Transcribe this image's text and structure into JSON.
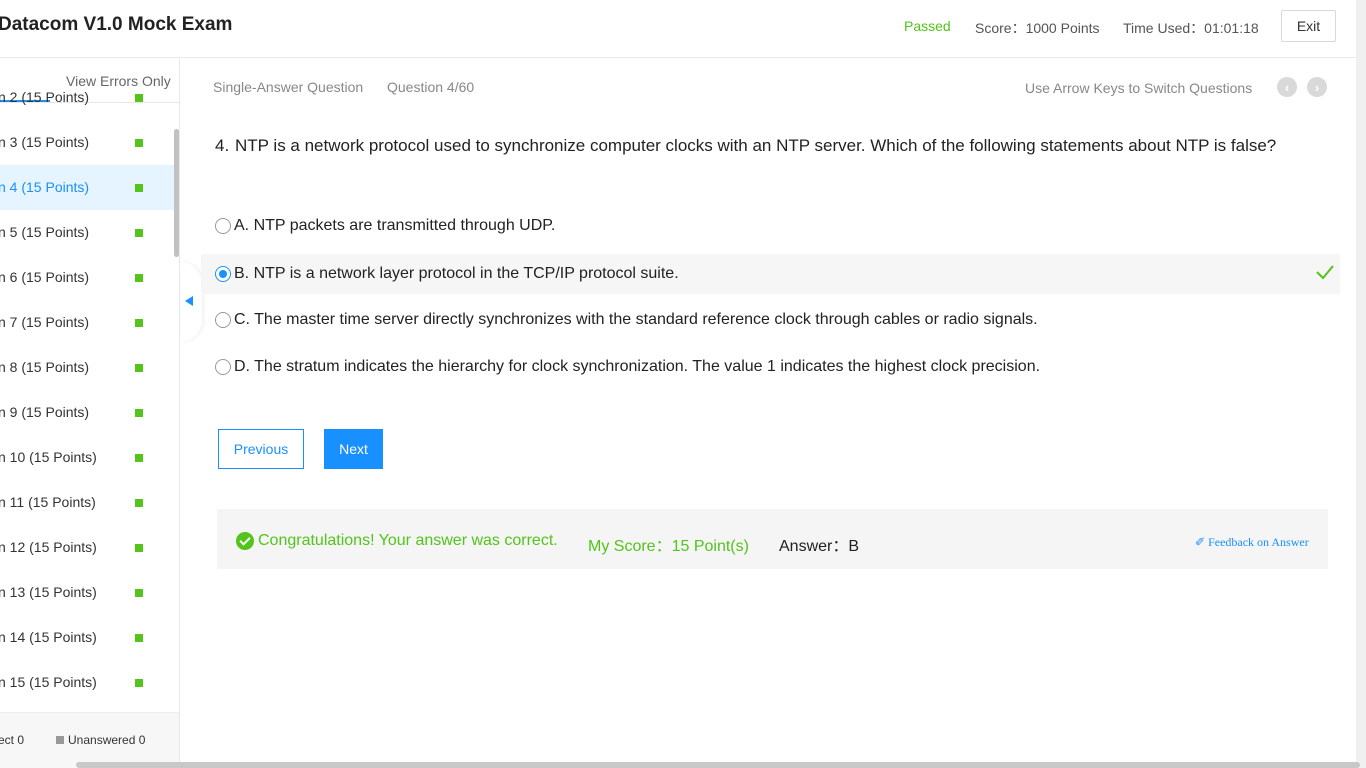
{
  "header": {
    "title": "Datacom V1.0 Mock Exam",
    "status": "Passed",
    "score": "Score：1000 Points",
    "time_used": "Time Used：01:01:18",
    "exit_label": "Exit"
  },
  "sidebar": {
    "tab_errors": "View Errors Only",
    "items": [
      {
        "label": "n 2   (15 Points)"
      },
      {
        "label": "n 3   (15 Points)"
      },
      {
        "label": "n 4   (15 Points)"
      },
      {
        "label": "n 5   (15 Points)"
      },
      {
        "label": "n 6   (15 Points)"
      },
      {
        "label": "n 7   (15 Points)"
      },
      {
        "label": "n 8   (15 Points)"
      },
      {
        "label": "n 9   (15 Points)"
      },
      {
        "label": "n 10   (15 Points)"
      },
      {
        "label": "n 11   (15 Points)"
      },
      {
        "label": "n 12   (15 Points)"
      },
      {
        "label": "n 13   (15 Points)"
      },
      {
        "label": "n 14   (15 Points)"
      },
      {
        "label": "n 15   (15 Points)"
      }
    ],
    "active_index": 2,
    "footer_correct": "ect 0",
    "footer_unanswered": "Unanswered 0"
  },
  "question_bar": {
    "type": "Single-Answer Question",
    "number": "Question 4/60",
    "hint": "Use Arrow Keys to Switch Questions"
  },
  "question": {
    "num": "4.",
    "text": "NTP is a network protocol used to synchronize computer clocks with an NTP server. Which of the following statements about NTP is false?"
  },
  "options": [
    {
      "text": "A. NTP packets are transmitted through UDP."
    },
    {
      "text": "B. NTP is a network layer protocol in the TCP/IP protocol suite."
    },
    {
      "text": "C. The master time server directly synchronizes with the standard reference clock through cables or radio signals."
    },
    {
      "text": "D. The stratum indicates the hierarchy for clock synchronization. The value 1 indicates the highest clock precision."
    }
  ],
  "selected_option": "B",
  "buttons": {
    "previous": "Previous",
    "next": "Next"
  },
  "result": {
    "message": "Congratulations! Your answer was correct.",
    "my_score": "My Score：15 Point(s)",
    "answer": "Answer：B",
    "feedback": "Feedback on Answer"
  },
  "colors": {
    "accent": "#1890ff",
    "success": "#52c41a"
  }
}
